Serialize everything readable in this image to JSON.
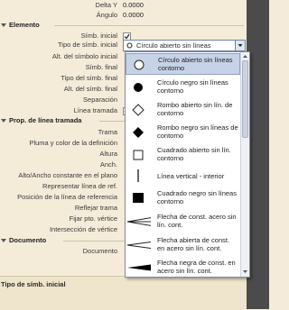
{
  "top_rows": [
    {
      "label": "Delta Y",
      "value": "0.0000"
    },
    {
      "label": "Ángulo",
      "value": "0.0000"
    }
  ],
  "sections": {
    "elemento": "Elemento",
    "prop_linea": "Prop. de línea tramada",
    "documento": "Documento"
  },
  "elemento_rows": {
    "simb_inicial": "Símb. inicial",
    "tipo_simb_inicial": "Tipo de símb. inicial",
    "alt_simb_inicial": "Alt. del símbolo inicial",
    "simb_final": "Símb. final",
    "tipo_simb_final": "Tipo del símb. final",
    "alt_simb_final": "Alt. del símb. final",
    "separacion": "Separación",
    "linea_tramada": "Línea tramada"
  },
  "linea_rows": [
    "Trama",
    "Pluma y color de la definición",
    "Altura",
    "Anch.",
    "Alto/Ancho constante en el plano",
    "Representar línea de ref.",
    "Posición de la línea de referencia",
    "Reflejar trama",
    "Fijar pto. vértice",
    "Intersección de vértice"
  ],
  "documento_rows": [
    "Documento"
  ],
  "combo": {
    "value": "Círculo abierto sin líneas"
  },
  "dropdown_items": [
    {
      "icon": "open-circle-icon",
      "label": "Círculo abierto sin líneas contorno"
    },
    {
      "icon": "filled-circle-icon",
      "label": "Círculo negro sin líneas contorno"
    },
    {
      "icon": "open-diamond-icon",
      "label": "Rombo abierto sin lín. de contorno"
    },
    {
      "icon": "filled-diamond-icon",
      "label": "Rombo negro sin líneas de contorno"
    },
    {
      "icon": "open-square-icon",
      "label": "Cuadrado abierto sin lín. contorno"
    },
    {
      "icon": "vertical-line-icon",
      "label": "Línea vertical - interior"
    },
    {
      "icon": "filled-square-icon",
      "label": "Cuadrado negro sin líneas contorno"
    },
    {
      "icon": "arrow-open-wide-icon",
      "label": "Flecha de const. acero sin lín. cont."
    },
    {
      "icon": "arrow-open-icon",
      "label": "Flecha abierta de const. en acero sin lín. cont."
    },
    {
      "icon": "arrow-filled-icon",
      "label": "Flecha negra de const. en acero sin lín. cont."
    }
  ],
  "status": {
    "description": "Tipo de símb. inicial"
  }
}
